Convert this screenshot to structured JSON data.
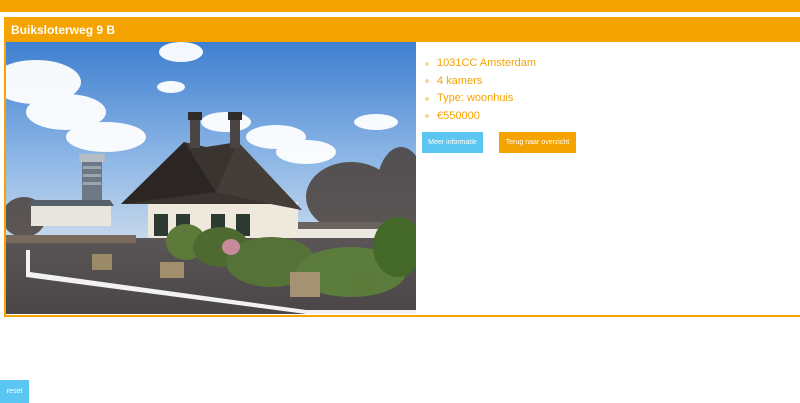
{
  "listing": {
    "title": "Buiksloterweg 9 B",
    "photo_alt": "Woonhuis aan de Buiksloterweg met A'DAM Toren op de achtergrond",
    "details": [
      "1031CC Amsterdam",
      "4 kamers",
      "Type: woonhuis",
      "€550000"
    ]
  },
  "buttons": {
    "more_info": "Meer informatie",
    "back": "Terug naar overzicht",
    "reset": "reset"
  },
  "colors": {
    "accent": "#f5a300",
    "button_blue": "#5cc6f2"
  }
}
